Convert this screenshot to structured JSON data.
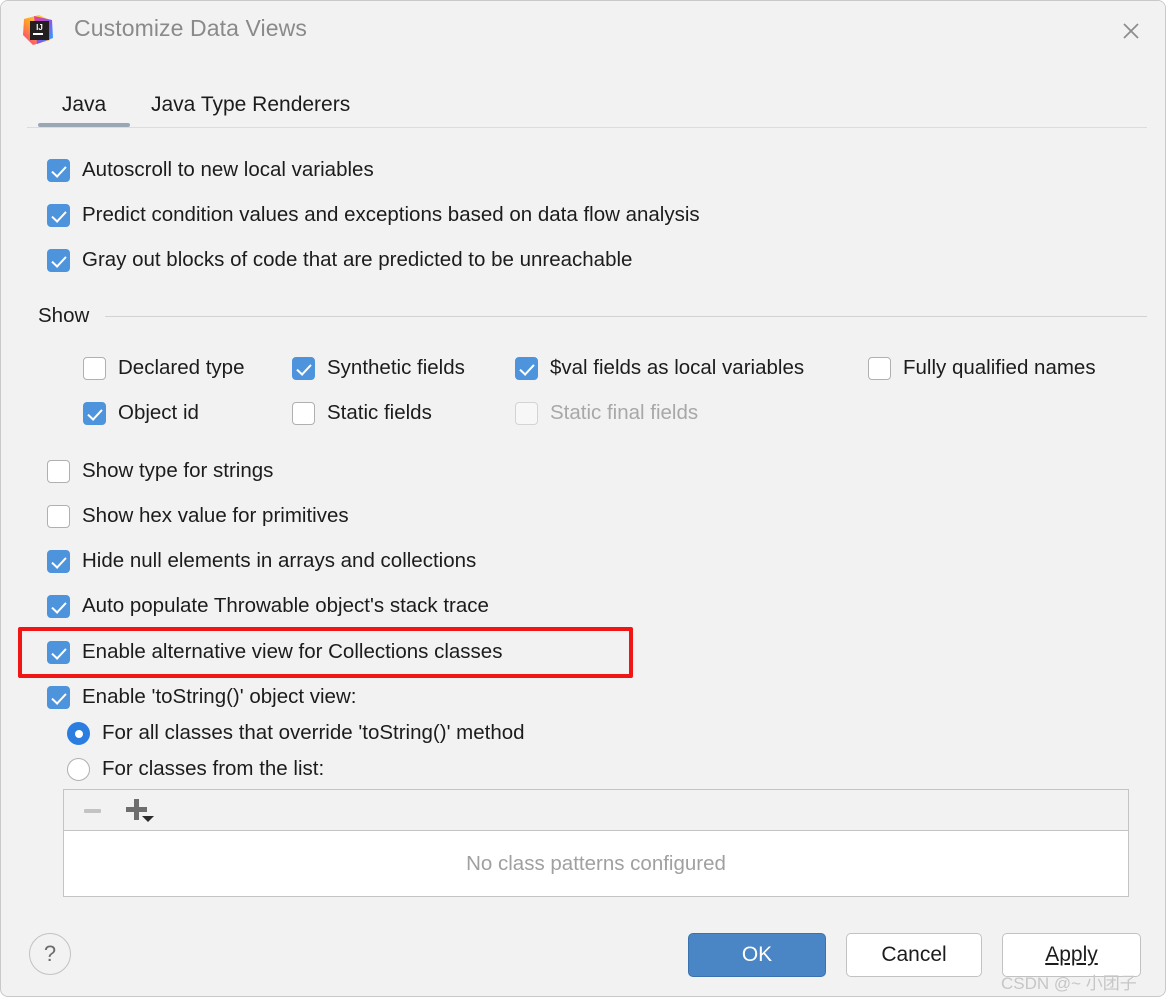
{
  "window": {
    "title": "Customize Data Views",
    "logo_icon": "intellij-idea-logo",
    "close_icon": "close-icon"
  },
  "tabs": [
    {
      "label": "Java",
      "selected": true
    },
    {
      "label": "Java Type Renderers",
      "selected": false
    }
  ],
  "top_options": [
    {
      "label": "Autoscroll to new local variables",
      "checked": true,
      "mnemonic": "o"
    },
    {
      "label": "Predict condition values and exceptions based on data flow analysis",
      "checked": true,
      "mnemonic": ""
    },
    {
      "label": "Gray out blocks of code that are predicted to be unreachable",
      "checked": true,
      "mnemonic": ""
    }
  ],
  "show_group": {
    "title": "Show",
    "items": [
      {
        "label": "Declared type",
        "checked": false,
        "enabled": true,
        "mnemonic": "y"
      },
      {
        "label": "Synthetic fields",
        "checked": true,
        "enabled": true,
        "mnemonic": "y"
      },
      {
        "label": "$val fields as local variables",
        "checked": true,
        "enabled": true,
        "mnemonic": "a"
      },
      {
        "label": "Fully qualified names",
        "checked": false,
        "enabled": true,
        "mnemonic": "q"
      },
      {
        "label": "Object id",
        "checked": true,
        "enabled": true,
        "mnemonic": "d"
      },
      {
        "label": "Static fields",
        "checked": false,
        "enabled": true,
        "mnemonic": "S"
      },
      {
        "label": "Static final fields",
        "checked": false,
        "enabled": false,
        "mnemonic": "f"
      }
    ]
  },
  "mid_options": [
    {
      "label": "Show type for strings",
      "checked": false,
      "mnemonic": ""
    },
    {
      "label": "Show hex value for primitives",
      "checked": false,
      "mnemonic": ""
    },
    {
      "label": "Hide null elements in arrays and collections",
      "checked": true,
      "mnemonic": "n"
    },
    {
      "label": "Auto populate Throwable object's stack trace",
      "checked": true,
      "mnemonic": ""
    },
    {
      "label": "Enable alternative view for Collections classes",
      "checked": true,
      "mnemonic": "c",
      "highlighted": true
    },
    {
      "label": "Enable 'toString()' object view:",
      "checked": true,
      "mnemonic": "S"
    }
  ],
  "tostring_radios": [
    {
      "label": "For all classes that override 'toString()' method",
      "selected": true
    },
    {
      "label": "For classes from the list:",
      "selected": false
    }
  ],
  "class_list": {
    "remove_icon": "minus-icon",
    "add_icon": "plus-icon",
    "add_dropdown_icon": "chevron-down-icon",
    "empty_text": "No class patterns configured"
  },
  "footer": {
    "help_icon": "question-mark-icon",
    "ok_label": "OK",
    "cancel_label": "Cancel",
    "apply_label": "Apply",
    "apply_mnemonic": "A"
  },
  "watermark": {
    "text": "CSDN @~ 小团子"
  },
  "colors": {
    "accent_blue": "#4d94dd",
    "ok_button_blue": "#4a86c5",
    "highlight_red": "#f01616",
    "dialog_bg": "#f2f2f2"
  }
}
